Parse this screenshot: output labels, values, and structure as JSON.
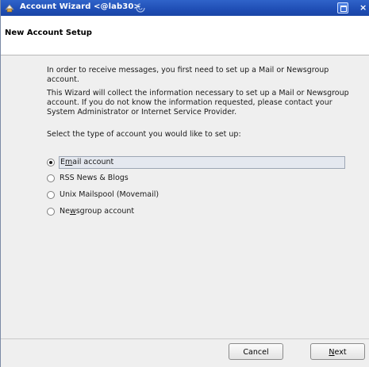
{
  "window": {
    "title": "Account Wizard <@lab30>",
    "close_glyph": "×"
  },
  "header": {
    "title": "New Account Setup"
  },
  "body": {
    "para1": "In order to receive messages, you first need to set up a Mail or Newsgroup account.",
    "para2": "This Wizard will collect the information necessary to set up a Mail or Newsgroup account. If you do not know the information requested, please contact your System Administrator or Internet Service Provider.",
    "para3": "Select the type of account you would like to set up:"
  },
  "options": [
    {
      "pre": "E",
      "accel": "m",
      "post": "ail account",
      "selected": true
    },
    {
      "pre": "RSS News & Blogs",
      "accel": "",
      "post": "",
      "selected": false
    },
    {
      "pre": "Unix Mailspool (Movemail)",
      "accel": "",
      "post": "",
      "selected": false
    },
    {
      "pre": "Ne",
      "accel": "w",
      "post": "sgroup account",
      "selected": false
    }
  ],
  "footer": {
    "cancel_label": "Cancel",
    "next_accel": "N",
    "next_rest": "ext"
  },
  "icons": {
    "app": "account-wizard-icon",
    "maximize": "maximize-icon",
    "close": "close-icon"
  }
}
